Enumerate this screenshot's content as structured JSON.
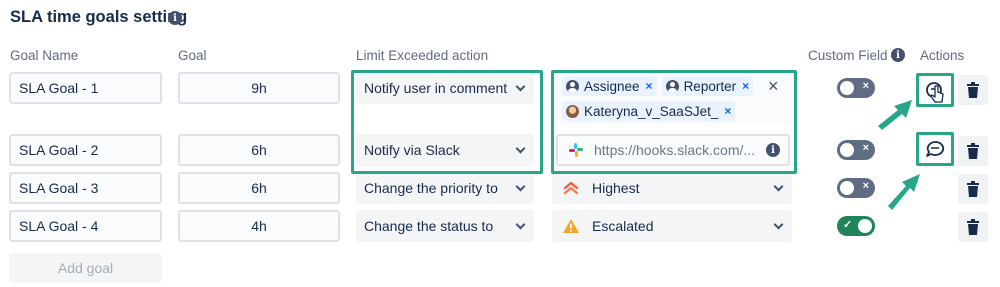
{
  "title": "SLA time goals setting",
  "info_glyph": "i",
  "headers": {
    "goal_name": "Goal Name",
    "goal": "Goal",
    "action": "Limit Exceeded action",
    "custom_field": "Custom Field",
    "actions": "Actions"
  },
  "rows": [
    {
      "name": "SLA Goal - 1",
      "goal": "9h",
      "action": "Notify user in comment",
      "custom_field_on": false
    },
    {
      "name": "SLA Goal - 2",
      "goal": "6h",
      "action": "Notify via Slack",
      "custom_field_on": false
    },
    {
      "name": "SLA Goal - 3",
      "goal": "6h",
      "action": "Change the priority to",
      "custom_field_on": false
    },
    {
      "name": "SLA Goal - 4",
      "goal": "4h",
      "action": "Change the status to",
      "custom_field_on": true
    }
  ],
  "recipients": {
    "tags": [
      "Assignee",
      "Reporter",
      "Kateryna_v_SaaSJet_"
    ],
    "clear": "×",
    "tag_remove": "×"
  },
  "slack_webhook": {
    "value": "https://hooks.slack.com/..."
  },
  "priority_value": "Highest",
  "status_value": "Escalated",
  "toggle_marks": {
    "off": "×",
    "on": "✓"
  },
  "add_goal": "Add goal",
  "colors": {
    "highlight": "#27a689",
    "toggle_off": "#5e6c84",
    "toggle_on": "#1f845a",
    "priority": "#ff5630",
    "warning": "#f5a623"
  },
  "icons": [
    "info-icon",
    "user-icon",
    "slack-icon",
    "highest-priority-icon",
    "warning-icon",
    "comment-icon",
    "trash-icon",
    "cursor-icon",
    "arrow-icon"
  ]
}
